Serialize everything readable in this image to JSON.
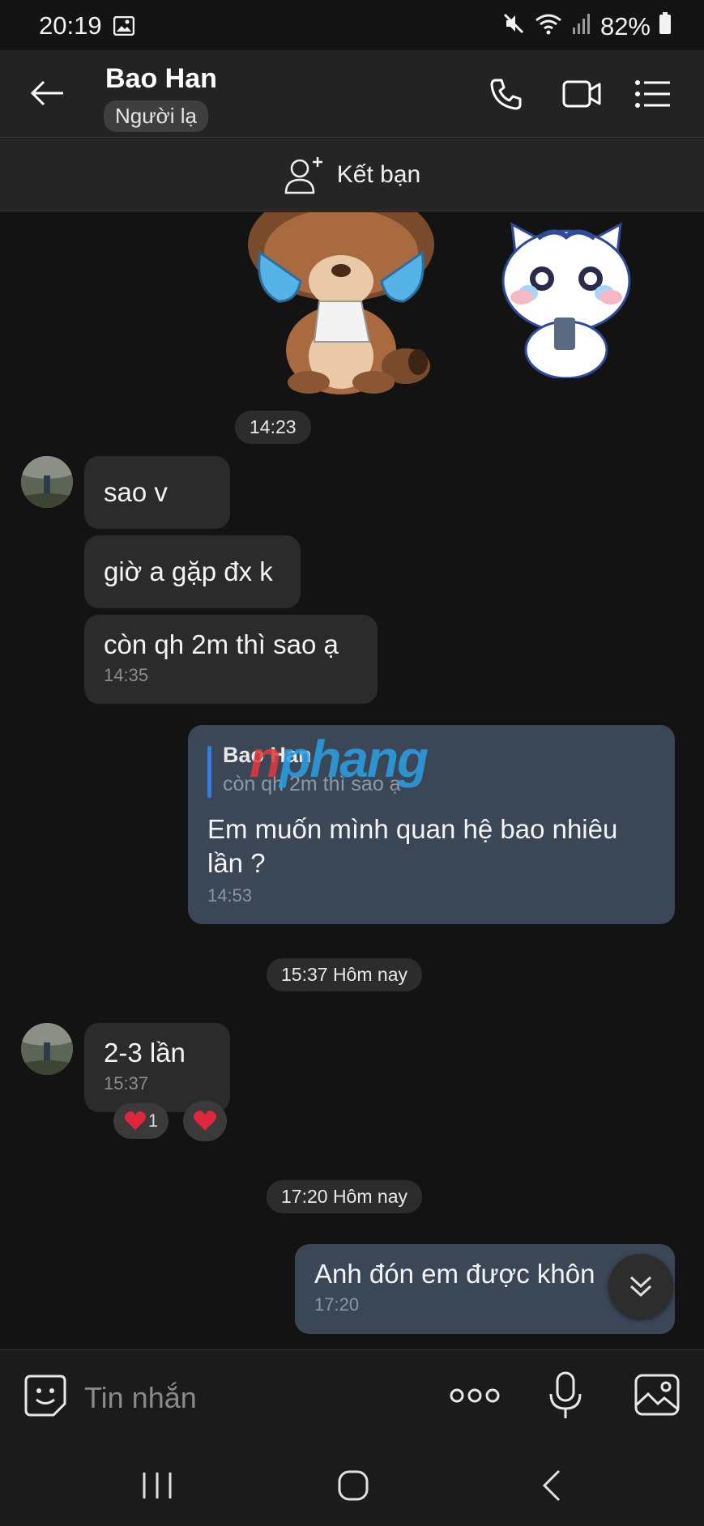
{
  "status_bar": {
    "time": "20:19",
    "battery": "82%"
  },
  "header": {
    "contact_name": "Bao Han",
    "badge": "Người lạ"
  },
  "add_friend": {
    "label": "Kết bạn"
  },
  "chips": {
    "t1": "14:23",
    "t2": "15:37 Hôm nay",
    "t3": "17:20 Hôm nay"
  },
  "messages": {
    "m1": {
      "text": "sao v"
    },
    "m2": {
      "text": "giờ a gặp đx k"
    },
    "m3": {
      "text": "còn qh 2m thì sao ạ",
      "time": "14:35"
    },
    "m4": {
      "quote_name": "Bao Han",
      "quote_text": "còn qh 2m thì sao ạ",
      "text": "Em muốn mình quan hệ bao nhiêu lần ?",
      "time": "14:53"
    },
    "m5": {
      "text": "2-3 lần",
      "time": "15:37",
      "reaction_count": "1"
    },
    "m6": {
      "text": "Anh đón em được khôn",
      "time": "17:20"
    }
  },
  "watermark": {
    "text_a": "n",
    "text_b": "phang"
  },
  "composer": {
    "placeholder": "Tin nhắn"
  },
  "colors": {
    "background": "#131313",
    "incoming_bubble": "#2b2b2b",
    "outgoing_bubble": "#3b4757",
    "quote_bar": "#3a7bd5",
    "heart": "#e0253f"
  }
}
